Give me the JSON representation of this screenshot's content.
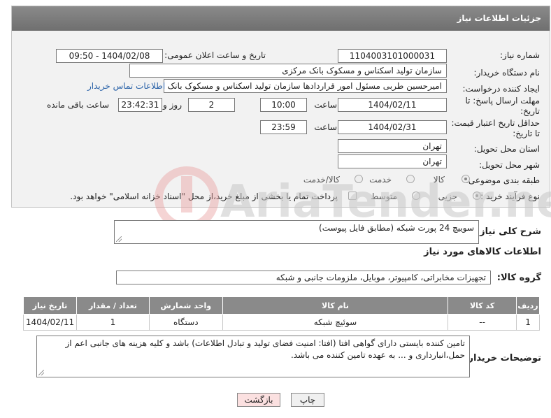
{
  "header": {
    "title": "جزئیات اطلاعات نیاز"
  },
  "form": {
    "need_number_label": "شماره نیاز:",
    "need_number": "1104003101000031",
    "announce_label": "تاریخ و ساعت اعلان عمومی:",
    "announce_value": "1404/02/08 - 09:50",
    "buyer_org_label": "نام دستگاه خریدار:",
    "buyer_org": "سازمان تولید اسکناس و مسکوک بانک مرکزی",
    "creator_label": "ایجاد کننده درخواست:",
    "creator": "امیرحسین طربی مسئول امور قراردادها سازمان تولید اسکناس و مسکوک بانک مرکزی",
    "contact_link": "اطلاعات تماس خریدار",
    "deadline_label_1": "مهلت ارسال پاسخ: تا",
    "deadline_label_2": "تاریخ:",
    "deadline_date": "1404/02/11",
    "time_label": "ساعت",
    "deadline_time": "10:00",
    "days_value": "2",
    "days_label": "روز و",
    "remaining_time": "23:42:31",
    "remaining_label": "ساعت باقی مانده",
    "price_label_1": "حداقل تاریخ اعتبار قیمت:",
    "price_label_2": "تا تاریخ:",
    "price_date": "1404/02/31",
    "price_time": "23:59",
    "province_label": "استان محل تحویل:",
    "province": "تهران",
    "city_label": "شهر محل تحویل:",
    "city": "تهران",
    "category_label": "طبقه بندی موضوعی:",
    "category_options": [
      "کالا",
      "خدمت",
      "کالا/خدمت"
    ],
    "category_selected": "کالا",
    "process_label": "نوع فرآیند خرید :",
    "process_options": [
      "جزیی",
      "متوسط"
    ],
    "process_selected": "جزیی",
    "payment_note": "پرداخت تمام یا بخشی از مبلغ خرید،از محل \"اسناد خزانه اسلامی\" خواهد بود."
  },
  "description": {
    "label": "شرح کلی نیاز:",
    "value": "سوییچ 24  پورت شبکه (مطابق فایل پیوست)"
  },
  "goods": {
    "section_title": "اطلاعات کالاهای مورد نیاز",
    "group_label": "گروه کالا:",
    "group_value": "تجهیزات مخابراتی، کامپیوتر، موبایل، ملزومات جانبی و شبکه",
    "table": {
      "headers": [
        "ردیف",
        "کد کالا",
        "نام کالا",
        "واحد شمارش",
        "تعداد / مقدار",
        "تاریخ نیاز"
      ],
      "rows": [
        [
          "1",
          "--",
          "سوئیچ شبکه",
          "دستگاه",
          "1",
          "1404/02/11"
        ]
      ]
    }
  },
  "buyer_notes": {
    "label": "توضیحات خریدار:",
    "value": "تامین کننده بایستی دارای گواهی افتا (افتا: امنیت فضای تولید و تبادل اطلاعات) باشد و کلیه هزینه های جانبی اعم از حمل،انبارداری و ... به عهده تامین کننده می باشد."
  },
  "buttons": {
    "print": "چاپ",
    "back": "بازگشت"
  },
  "watermark": {
    "text": "AriaTender.neT"
  }
}
